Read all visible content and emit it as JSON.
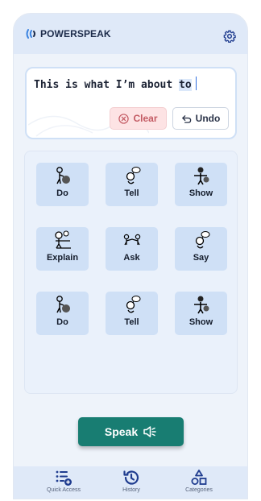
{
  "app": {
    "brand": "POWERSPEAK",
    "logo_icon": "sound-waves-icon",
    "settings_icon": "gear-icon"
  },
  "sentence": {
    "text_before": "This is what I’m about ",
    "text_highlight": "to",
    "clear_label": "Clear",
    "clear_icon": "x-circle-icon",
    "undo_label": "Undo",
    "undo_icon": "undo-arrow-icon"
  },
  "tiles": [
    {
      "label": "Do",
      "icon": "person-with-ball-icon"
    },
    {
      "label": "Tell",
      "icon": "person-speech-bubble-icon"
    },
    {
      "label": "Show",
      "icon": "person-showing-icon"
    },
    {
      "label": "Explain",
      "icon": "person-explaining-icon"
    },
    {
      "label": "Ask",
      "icon": "two-people-asking-icon"
    },
    {
      "label": "Say",
      "icon": "person-speech-bubble-icon"
    },
    {
      "label": "Do",
      "icon": "person-with-ball-icon"
    },
    {
      "label": "Tell",
      "icon": "person-speech-bubble-icon"
    },
    {
      "label": "Show",
      "icon": "person-showing-icon"
    }
  ],
  "speak": {
    "label": "Speak",
    "icon": "speaker-icon"
  },
  "bottom_nav": [
    {
      "label": "Quick Access",
      "icon": "list-plus-icon"
    },
    {
      "label": "History",
      "icon": "history-icon"
    },
    {
      "label": "Categories",
      "icon": "shapes-icon"
    }
  ],
  "colors": {
    "accent": "#187d72",
    "header_bg": "#dfe9f8",
    "tile_bg": "#cfe0f6",
    "clear_text": "#c35a63"
  }
}
